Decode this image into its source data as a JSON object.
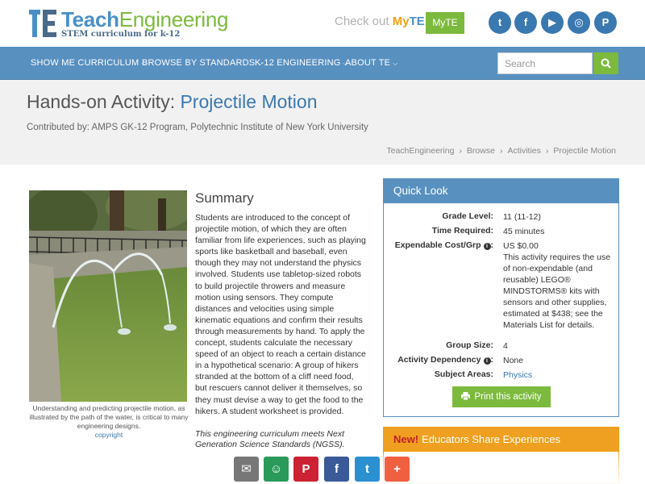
{
  "header": {
    "logo_teach": "Teach",
    "logo_engineering": "Engineering",
    "logo_tagline": "STEM curriculum for k-12",
    "checkout_prefix": "Check out ",
    "checkout_my": "My",
    "checkout_te": "TE",
    "myte_button": "MyTE",
    "social": [
      {
        "name": "twitter",
        "glyph": "t",
        "color": "#3a78b0"
      },
      {
        "name": "facebook",
        "glyph": "f",
        "color": "#3a78b0"
      },
      {
        "name": "youtube",
        "glyph": "▶",
        "color": "#3a78b0"
      },
      {
        "name": "instagram",
        "glyph": "◎",
        "color": "#3a78b0"
      },
      {
        "name": "pinterest",
        "glyph": "P",
        "color": "#3a78b0"
      }
    ]
  },
  "nav": {
    "items": [
      "SHOW ME CURRICULUM",
      "BROWSE BY STANDARDS",
      "K-12 ENGINEERING",
      "ABOUT TE"
    ],
    "search_placeholder": "Search",
    "search_icon": "search-icon"
  },
  "title": {
    "prefix": "Hands-on Activity: ",
    "name": "Projectile Motion",
    "contributor": "Contributed by: AMPS GK-12 Program, Polytechnic Institute of New York University"
  },
  "breadcrumb": [
    "TeachEngineering",
    "Browse",
    "Activities",
    "Projectile Motion"
  ],
  "image": {
    "caption": "Understanding and predicting projectile motion, as illustrated by the path of the water, is critical to many engineering designs.",
    "copyright": "copyright"
  },
  "summary": {
    "heading": "Summary",
    "text": "Students are introduced to the concept of projectile motion, of which they are often familiar from life experiences, such as playing sports like basketball and baseball, even though they may not understand the physics involved. Students use tabletop-sized robots to build projectile throwers and measure motion using sensors. They compute distances and velocities using simple kinematic equations and confirm their results through measurements by hand. To apply the concept, students calculate the necessary speed of an object to reach a certain distance in a hypothetical scenario: A group of hikers stranded at the bottom of a cliff need food, but rescuers cannot deliver it themselves, so they must devise a way to get the food to the hikers. A student worksheet is provided.",
    "ngss": "This engineering curriculum meets Next Generation Science Standards (NGSS)."
  },
  "quicklook": {
    "heading": "Quick Look",
    "grade_label": "Grade Level:",
    "grade_value": "11 (11-12)",
    "time_label": "Time Required:",
    "time_value": "45 minutes",
    "cost_label": "Expendable Cost/Grp",
    "cost_value": "US $0.00",
    "cost_note": "This activity requires the use of non-expendable (and reusable) LEGO® MINDSTORMS® kits with sensors and other supplies, estimated at $438; see the Materials List for details.",
    "group_label": "Group Size:",
    "group_value": "4",
    "dep_label": "Activity Dependency",
    "dep_value": "None",
    "subject_label": "Subject Areas:",
    "subject_value": "Physics",
    "print_button": "Print this activity"
  },
  "new_panel": {
    "badge": "New!",
    "heading": "Educators Share Experiences"
  },
  "share": [
    {
      "name": "email",
      "glyph": "✉",
      "color": "#777777"
    },
    {
      "name": "classroom",
      "glyph": "☺",
      "color": "#2a9a5a"
    },
    {
      "name": "pinterest",
      "glyph": "P",
      "color": "#cc2233"
    },
    {
      "name": "facebook",
      "glyph": "f",
      "color": "#3a5a98"
    },
    {
      "name": "twitter",
      "glyph": "t",
      "color": "#2a90d0"
    },
    {
      "name": "more",
      "glyph": "+",
      "color": "#f06040"
    }
  ]
}
